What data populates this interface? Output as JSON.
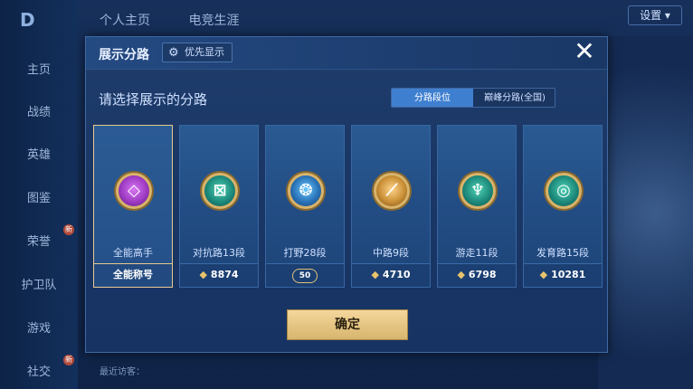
{
  "background": {
    "logo_glyph": "D",
    "nav_items": [
      {
        "label": "主页",
        "badge": ""
      },
      {
        "label": "战绩",
        "badge": ""
      },
      {
        "label": "英雄",
        "badge": ""
      },
      {
        "label": "图鉴",
        "badge": ""
      },
      {
        "label": "荣誉",
        "badge": "新"
      },
      {
        "label": "护卫队",
        "badge": ""
      },
      {
        "label": "游戏",
        "badge": ""
      },
      {
        "label": "社交",
        "badge": "新"
      }
    ],
    "top_tabs": [
      "个人主页",
      "电竞生涯"
    ],
    "settings_label": "设置 ▾",
    "recent_visitors": "最近访客："
  },
  "modal": {
    "title": "展示分路",
    "pref_button": "优先显示",
    "pref_icon": "gear-icon",
    "close_glyph": "✕",
    "subtitle": "请选择展示的分路",
    "toggle": {
      "active": "分路段位",
      "inactive": "巅峰分路(全国)"
    },
    "cards": [
      {
        "name": "全能高手",
        "footer": "全能称号",
        "emblem": "purple",
        "glyph": "◇",
        "selected": true
      },
      {
        "name": "对抗路13段",
        "footer": "8874",
        "emblem": "green",
        "glyph": "⊠",
        "coin": "◆"
      },
      {
        "name": "打野28段",
        "footer": "50",
        "emblem": "blue",
        "glyph": "❂",
        "level_badge": true
      },
      {
        "name": "中路9段",
        "footer": "4710",
        "emblem": "gold",
        "glyph": "⟋",
        "coin": "◆"
      },
      {
        "name": "游走11段",
        "footer": "6798",
        "emblem": "green",
        "glyph": "♆",
        "coin": "◆"
      },
      {
        "name": "发育路15段",
        "footer": "10281",
        "emblem": "green",
        "glyph": "◎",
        "coin": "◆"
      }
    ],
    "confirm_label": "确定"
  }
}
